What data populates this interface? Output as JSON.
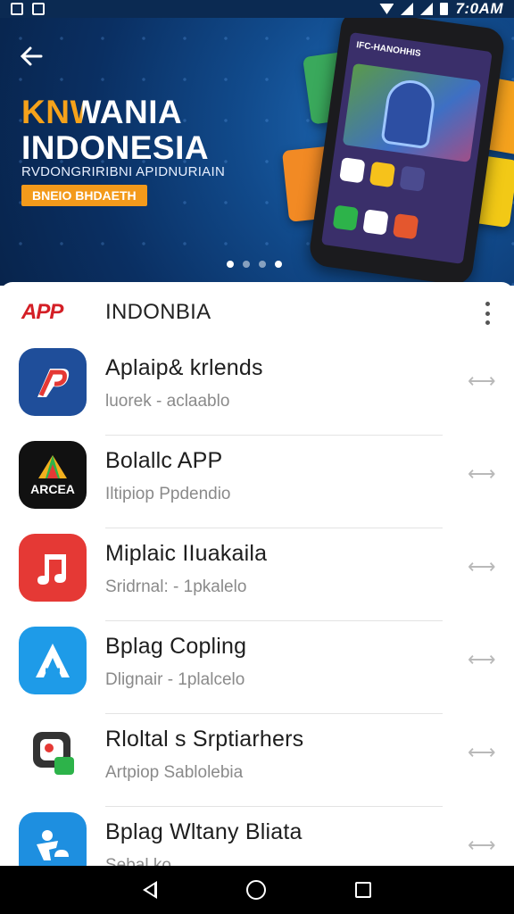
{
  "status_bar": {
    "time": "7:0AM"
  },
  "banner": {
    "title_line1": "KNWANIA",
    "title_line2": "INDONESIA",
    "subtitle": "RVDONGRIRIBNI APIDNURIAIN",
    "badge": "BNEIO BHDAETH",
    "phone_header": "IFC-HANOHHIS",
    "slide_count": 4,
    "active_slide": 1
  },
  "list": {
    "brand": "APP",
    "title": "INDONBIA",
    "apps": [
      {
        "name": "Aplaip& krlends",
        "sub": "luorek - aclaablo",
        "icon": "red-p-icon",
        "color": "#1f4e9a"
      },
      {
        "name": "Bolallc APP",
        "sub": "Iltipiop Ppdendio",
        "icon": "arcea-icon",
        "color": "#111111"
      },
      {
        "name": "Miplaic IIuakaila",
        "sub": "Sridrnal: - 1pkalelo",
        "icon": "music-note-icon",
        "color": "#e53935"
      },
      {
        "name": "Bplag Copling",
        "sub": "Dlignair - 1plalcelo",
        "icon": "a-letter-icon",
        "color": "#1e9be8"
      },
      {
        "name": "Rloltal s Srptiarhers",
        "sub": "Artpiop Sablolebia",
        "icon": "chat-bubble-icon",
        "color": "#ffffff"
      },
      {
        "name": "Bplag Wltany Bliata",
        "sub": "Sebal ko",
        "icon": "person-cloud-icon",
        "color": "#1e8fe0"
      }
    ]
  }
}
